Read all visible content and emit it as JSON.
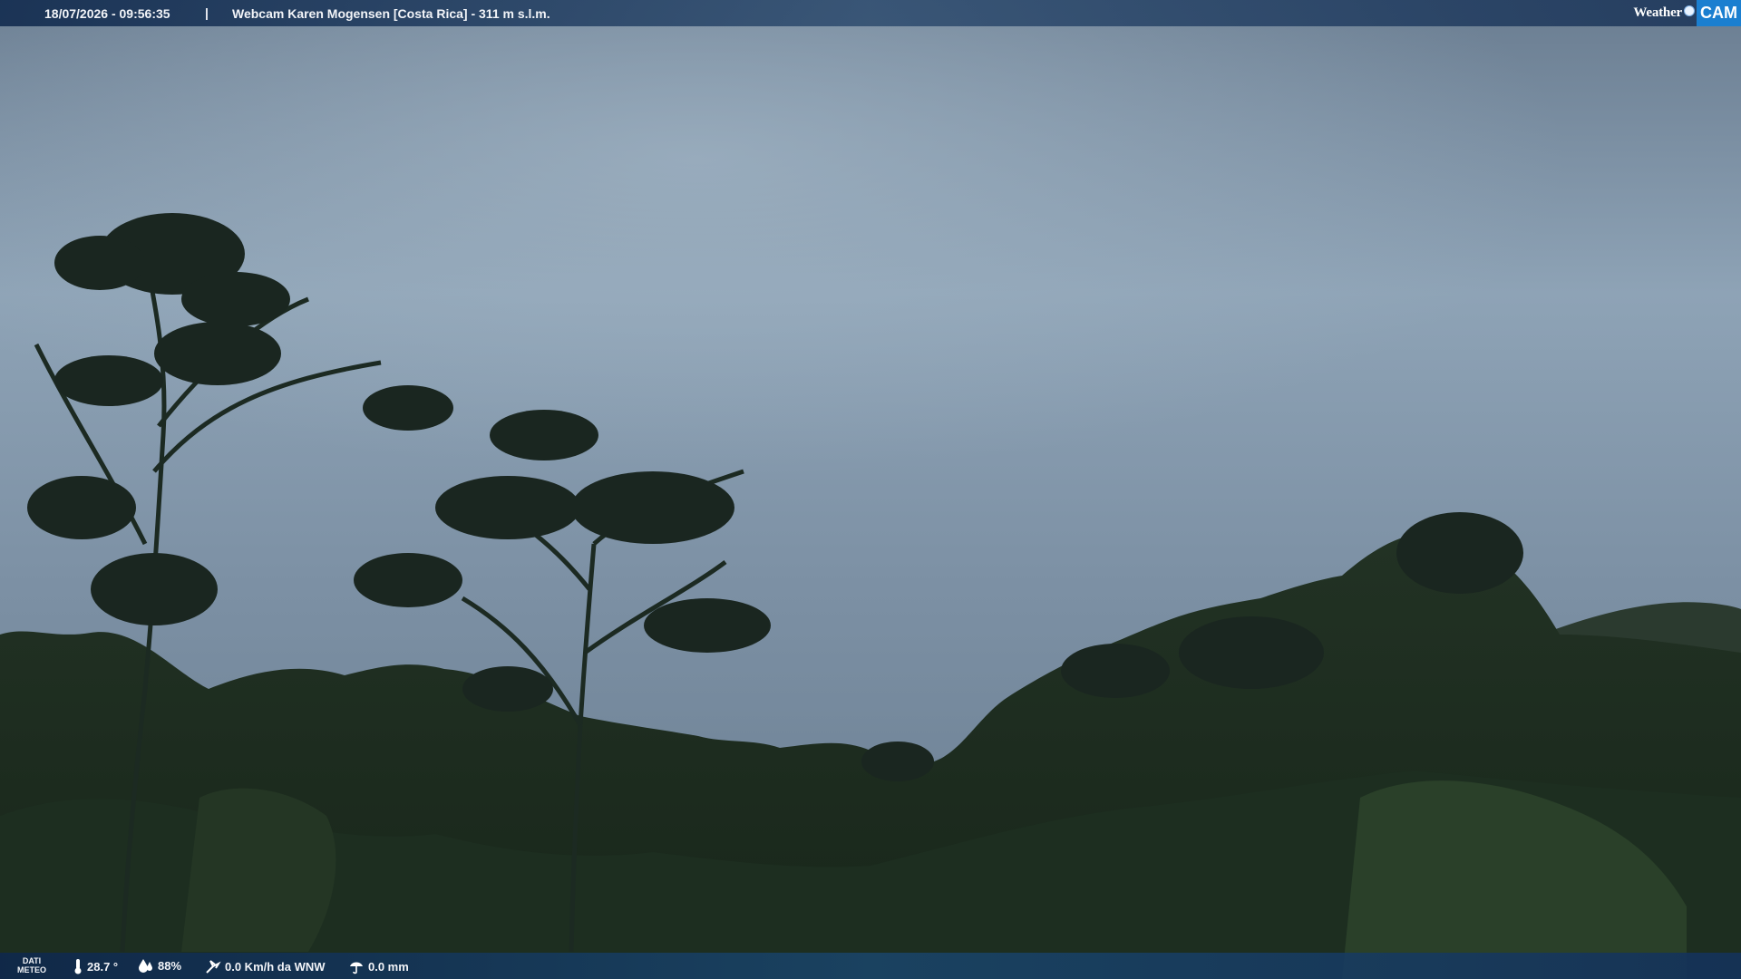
{
  "header": {
    "datetime": "18/07/2026 - 09:56:35",
    "separator": "|",
    "location": "Webcam Karen Mogensen [Costa Rica] - 311 m s.l.m."
  },
  "logo": {
    "weather": "Weather",
    "cam": "CAM"
  },
  "footer": {
    "meteo_line1": "DATI",
    "meteo_line2": "METEO",
    "temperature": "28.7 °",
    "humidity": "88%",
    "wind": "0.0 Km/h da WNW",
    "rain": "0.0 mm"
  },
  "colors": {
    "sky_top": "#6e8296",
    "sky_light": "#93a8ba",
    "forest": "#1c2b1f",
    "bar": "#1c3a62",
    "logo_blue": "#1b7fd0"
  },
  "icons": [
    "thermometer-icon",
    "humidity-icon",
    "wind-icon",
    "rain-icon"
  ]
}
